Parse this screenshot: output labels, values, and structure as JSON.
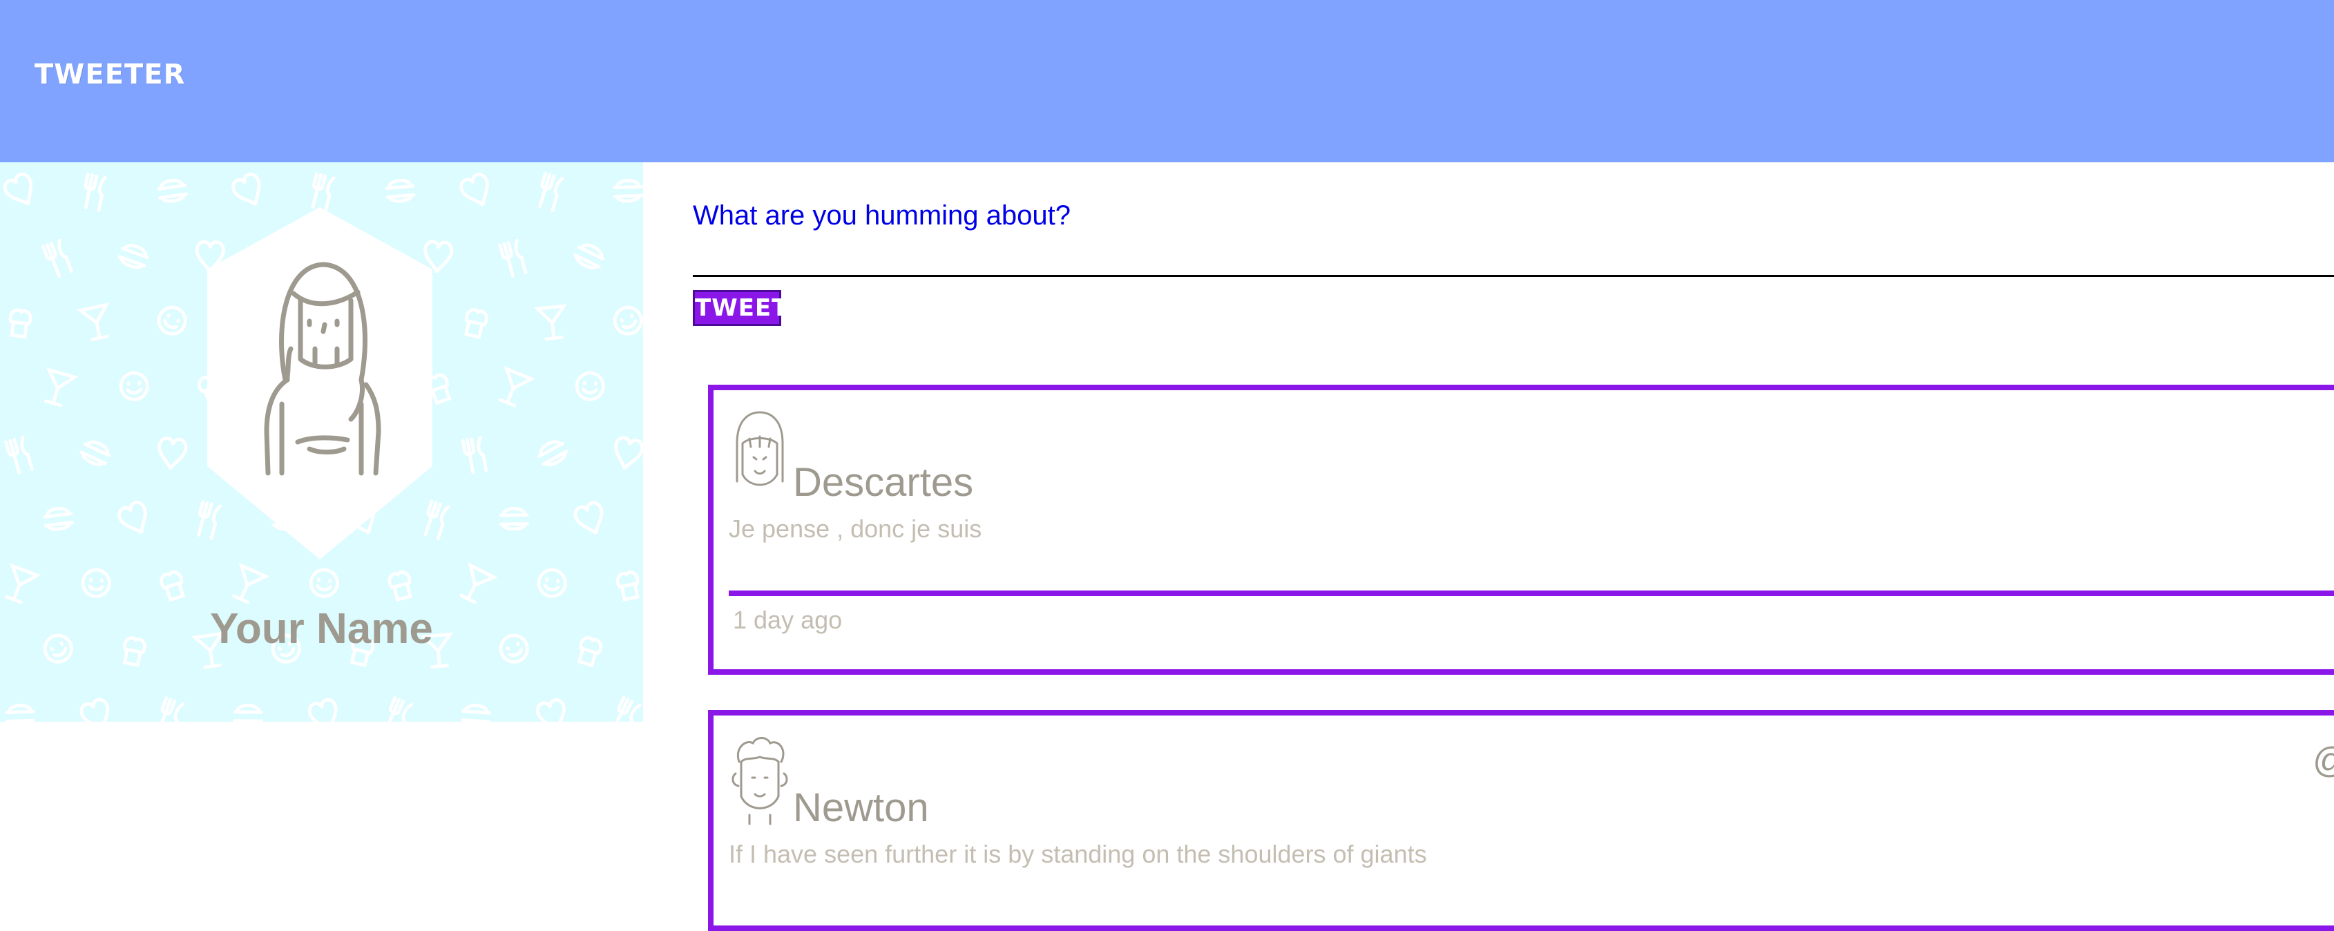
{
  "header": {
    "brand": "TWEETER",
    "background_color": "#7fa3ff"
  },
  "profile": {
    "name": "Your Name",
    "avatar_icon": "woman-avatar-icon",
    "background_color": "#dcfcff"
  },
  "composer": {
    "label": "What are you humming about?",
    "input_value": "",
    "button_label": "TWEET",
    "button_color": "#8a16e8"
  },
  "tweets": [
    {
      "author": "Descartes",
      "avatar_icon": "bob-hair-avatar-icon",
      "text": "Je pense , donc je suis",
      "time": "1 day ago"
    },
    {
      "author": "Newton",
      "avatar_icon": "curly-hair-avatar-icon",
      "text": "If I have seen further it is by standing on the shoulders of giants",
      "handle": "@"
    }
  ]
}
